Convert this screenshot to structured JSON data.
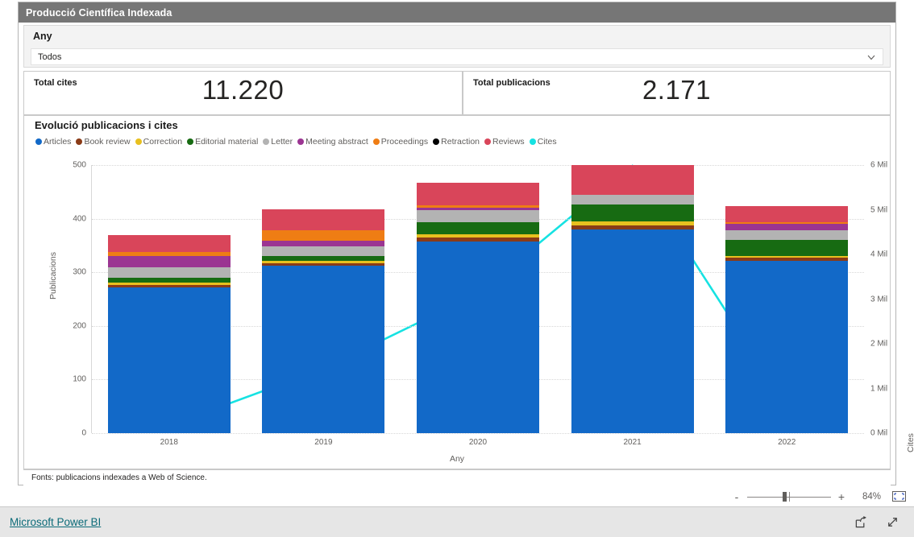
{
  "report": {
    "header_title": "Producció Científica Indexada"
  },
  "slicer": {
    "label": "Any",
    "value": "Todos",
    "chevron_icon": "chevron-down-icon"
  },
  "kpis": [
    {
      "label": "Total cites",
      "value": "11.220"
    },
    {
      "label": "Total publicacions",
      "value": "2.171"
    }
  ],
  "chart_card": {
    "title": "Evolució publicacions i cites",
    "footnote": "Fonts: publicacions indexades a Web of Science."
  },
  "zoom_bar": {
    "minus_label": "-",
    "plus_label": "+",
    "percent": "84%",
    "fit_icon": "fit-to-page-icon"
  },
  "footer": {
    "link_label": "Microsoft Power BI",
    "share_icon": "share-icon",
    "fullscreen_icon": "fullscreen-icon"
  },
  "chart_data": {
    "type": "bar",
    "subtype": "stacked-bar-with-line-combo",
    "title": "Evolució publicacions i cites",
    "xlabel": "Any",
    "ylabel": "Publicacions",
    "y2label": "Cites",
    "categories": [
      "2018",
      "2019",
      "2020",
      "2021",
      "2022"
    ],
    "ylim": [
      0,
      500
    ],
    "yticks": [
      "0",
      "100",
      "200",
      "300",
      "400",
      "500"
    ],
    "y2lim": [
      0,
      6000
    ],
    "y2ticks": [
      "0 Mil",
      "1 Mil",
      "2 Mil",
      "3 Mil",
      "4 Mil",
      "5 Mil",
      "6 Mil"
    ],
    "grid": true,
    "legend_position": "top-left",
    "series": [
      {
        "name": "Articles",
        "color": "#1269c8",
        "values": [
          272,
          312,
          358,
          380,
          322
        ]
      },
      {
        "name": "Book review",
        "color": "#8a3b17",
        "values": [
          5,
          5,
          7,
          8,
          5
        ]
      },
      {
        "name": "Correction",
        "color": "#e8c01f",
        "values": [
          4,
          4,
          6,
          7,
          4
        ]
      },
      {
        "name": "Editorial material",
        "color": "#176b12",
        "values": [
          9,
          10,
          22,
          32,
          29
        ]
      },
      {
        "name": "Letter",
        "color": "#b3b3b3",
        "values": [
          20,
          17,
          23,
          18,
          19
        ]
      },
      {
        "name": "Meeting abstract",
        "color": "#9b3592",
        "values": [
          21,
          11,
          5,
          0,
          12
        ]
      },
      {
        "name": "Proceedings",
        "color": "#ef7d14",
        "values": [
          7,
          19,
          4,
          0,
          2
        ]
      },
      {
        "name": "Retraction",
        "color": "#000000",
        "values": [
          0,
          0,
          0,
          0,
          0
        ]
      },
      {
        "name": "Reviews",
        "color": "#d9455a",
        "values": [
          32,
          39,
          42,
          55,
          31
        ]
      }
    ],
    "line_series": {
      "name": "Cites",
      "color": "#16e2e2",
      "axis": "right",
      "values": [
        170,
        1440,
        3120,
        5980,
        620
      ]
    }
  }
}
